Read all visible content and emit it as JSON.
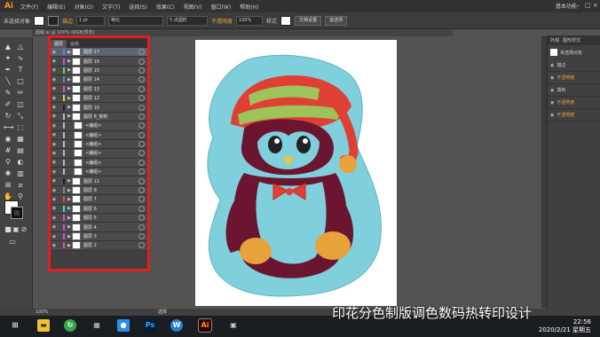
{
  "app": {
    "logo": "Ai",
    "workspace": "基本功能"
  },
  "menu": [
    "文件(F)",
    "编辑(E)",
    "对象(O)",
    "文字(T)",
    "选择(S)",
    "效果(C)",
    "视图(V)",
    "窗口(W)",
    "帮助(H)"
  ],
  "controlbar": {
    "selection_status": "未选择对象",
    "stroke_label": "描边",
    "stroke_weight": "1 pt",
    "profile": "等比",
    "brush": "5 点圆形",
    "opacity_label": "不透明度",
    "opacity_value": "100%",
    "style_label": "样式",
    "doc_setup": "文档设置",
    "preferences": "首选项"
  },
  "doc_tab": "图稿.ai @ 100% (RGB/预览)",
  "layers_panel": {
    "tabs": [
      "图层",
      "画板"
    ],
    "rows": [
      {
        "name": "图层 17",
        "color": "#4a90e2",
        "selected": true
      },
      {
        "name": "图层 16",
        "color": "#e04ae0",
        "selected": false
      },
      {
        "name": "图层 15",
        "color": "#6ad36a",
        "selected": false
      },
      {
        "name": "图层 14",
        "color": "#4a90e2",
        "selected": false
      },
      {
        "name": "图层 13",
        "color": "#e04ae0",
        "selected": false
      },
      {
        "name": "图层 12",
        "color": "#e0d04a",
        "selected": false
      },
      {
        "name": "图层 10",
        "color": "#1f1f1f",
        "selected": false
      },
      {
        "name": "图层 8_复制",
        "color": "#bbbbbb",
        "selected": false
      },
      {
        "name": "<编组>",
        "color": "#bbbbbb",
        "selected": false
      },
      {
        "name": "<编组>",
        "color": "#bbbbbb",
        "selected": false
      },
      {
        "name": "<编组>",
        "color": "#bbbbbb",
        "selected": false
      },
      {
        "name": "<编组>",
        "color": "#bbbbbb",
        "selected": false
      },
      {
        "name": "<编组>",
        "color": "#bbbbbb",
        "selected": false
      },
      {
        "name": "<编组>",
        "color": "#bbbbbb",
        "selected": false
      },
      {
        "name": "图层 11",
        "color": "#1f1f1f",
        "selected": false
      },
      {
        "name": "图层 9",
        "color": "#888888",
        "selected": false
      },
      {
        "name": "图层 7",
        "color": "#e04a4a",
        "selected": false
      },
      {
        "name": "图层 6",
        "color": "#4ad3e0",
        "selected": false
      },
      {
        "name": "图层 5",
        "color": "#e04ae0",
        "selected": false
      },
      {
        "name": "图层 4",
        "color": "#e04ae0",
        "selected": false
      },
      {
        "name": "图层 3",
        "color": "#e04ae0",
        "selected": false
      },
      {
        "name": "图层 2",
        "color": "#e04ae0",
        "selected": false
      }
    ]
  },
  "right_panel": {
    "tabs": [
      "外观",
      "图形样式"
    ],
    "title": "未选择对象",
    "rows": [
      "描边",
      "不透明度",
      "填色",
      "不透明度",
      "不透明度"
    ]
  },
  "status": {
    "zoom": "100%",
    "tool": "选择"
  },
  "taskbar": {
    "time": "22:56",
    "date": "2020/2/21 星期五"
  },
  "watermark": "印花分色制版调色数码热转印设计",
  "colors": {
    "artwork_bg": "#7fcfdc",
    "hat_red": "#e03f33",
    "hat_green": "#9cc45a",
    "penguin_body": "#6b1531",
    "highlight_red": "#e01f1f"
  }
}
